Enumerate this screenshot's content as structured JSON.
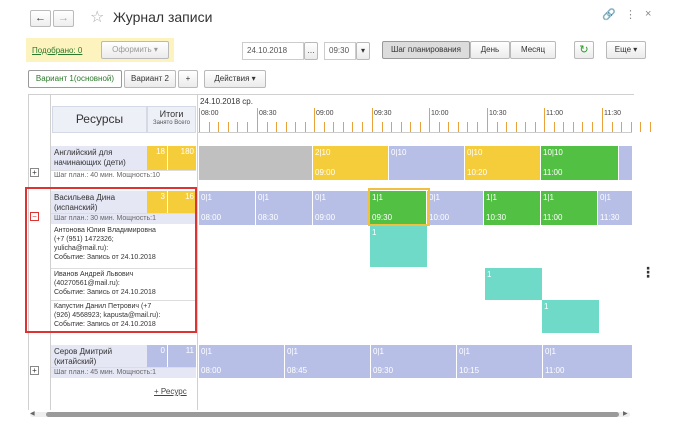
{
  "window": {
    "title": "Журнал записи"
  },
  "toolbar": {
    "selected_link": "Подобрано: 0",
    "format_button": "Оформить",
    "date_value": "24.10.2018",
    "time_value": "09:30",
    "planning_step_button": "Шаг планирования",
    "day_button": "День",
    "month_button": "Месяц",
    "more_button": "Еще"
  },
  "variants": {
    "tabs": [
      "Вариант 1(основной)",
      "Вариант 2"
    ],
    "add": "+",
    "actions": "Действия"
  },
  "grid": {
    "resources_header": "Ресурсы",
    "totals_header": "Итоги",
    "busy_label": "Занято",
    "total_label": "Всего",
    "date_header": "24.10.2018 ср.",
    "times": [
      "08:00",
      "08:30",
      "09:00",
      "09:30",
      "10:00",
      "10:30",
      "11:00",
      "11:30"
    ],
    "add_resource": "+ Ресурс"
  },
  "resources": [
    {
      "name": "Английский для начинающих (дети)",
      "meta": "Шаг план.: 40 мин. Мощность:10",
      "busy": "18",
      "total": "180",
      "cells": [
        {
          "top": "2|10",
          "bottom": "09:00"
        },
        {
          "top": "0|10",
          "bottom": ""
        },
        {
          "top": "0|10",
          "bottom": "10:20"
        },
        {
          "top": "10|10",
          "bottom": "11:00"
        }
      ]
    },
    {
      "name": "Васильева Дина (испанский)",
      "meta": "Шаг план.: 30 мин. Мощность:1",
      "busy": "3",
      "total": "16",
      "cells": [
        {
          "top": "0|1",
          "bottom": "08:00"
        },
        {
          "top": "0|1",
          "bottom": "08:30"
        },
        {
          "top": "0|1",
          "bottom": "09:00"
        },
        {
          "top": "1|1",
          "bottom": "09:30"
        },
        {
          "top": "0|1",
          "bottom": "10:00"
        },
        {
          "top": "1|1",
          "bottom": "10:30"
        },
        {
          "top": "1|1",
          "bottom": "11:00"
        },
        {
          "top": "0|1",
          "bottom": "11:30"
        }
      ],
      "bookings": [
        {
          "lines": [
            "Антонова Юлия Владимировна",
            "(+7 (951) 1472326;",
            "yulicha@mail.ru):",
            "Событие: Запись от 24.10.2018"
          ],
          "count": "1"
        },
        {
          "lines": [
            "Иванов Андрей Львович",
            "(40270561@mail.ru):",
            "Событие: Запись от 24.10.2018"
          ],
          "count": "1"
        },
        {
          "lines": [
            "Капустин Данил Петрович (+7",
            "(926) 4568923; kapusta@mail.ru):",
            "Событие: Запись от 24.10.2018"
          ],
          "count": "1"
        }
      ]
    },
    {
      "name": "Серов Дмитрий (китайский)",
      "meta": "Шаг план.: 45 мин. Мощность:1",
      "busy": "0",
      "total": "11",
      "cells": [
        {
          "top": "0|1",
          "bottom": "08:00"
        },
        {
          "top": "0|1",
          "bottom": "08:45"
        },
        {
          "top": "0|1",
          "bottom": "09:30"
        },
        {
          "top": "0|1",
          "bottom": "10:15"
        },
        {
          "top": "0|1",
          "bottom": "11:00"
        }
      ]
    }
  ]
}
